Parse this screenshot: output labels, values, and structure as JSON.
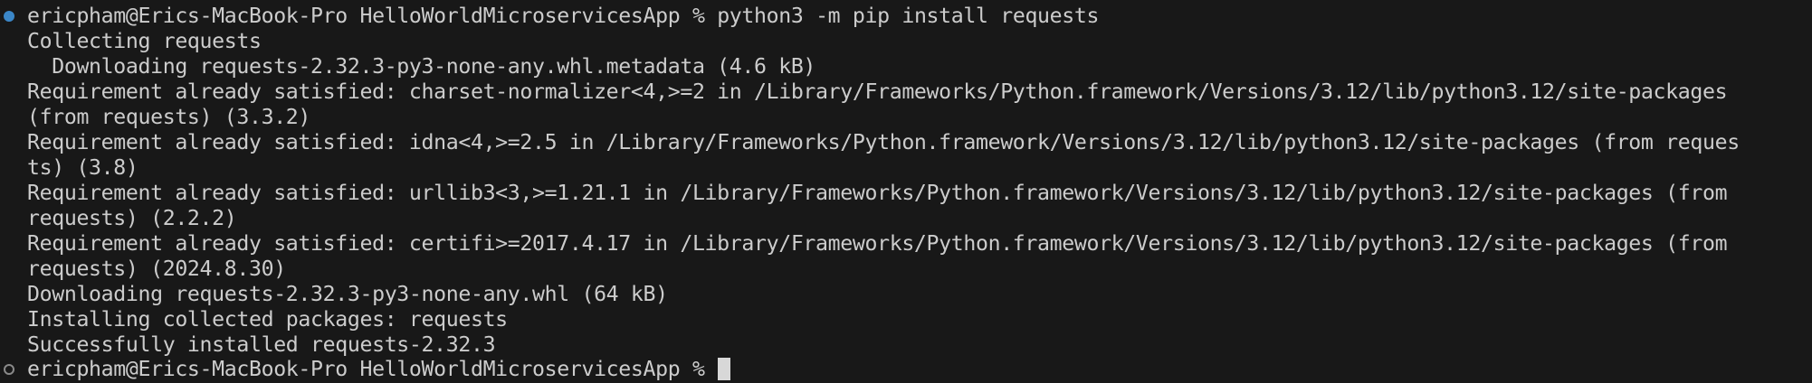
{
  "terminal": {
    "colors": {
      "background": "#181818",
      "text": "#cccccc",
      "success_marker": "#3b87c8",
      "idle_marker": "#8a8a8a"
    },
    "first_command": {
      "prompt": "ericpham@Erics-MacBook-Pro HelloWorldMicroservicesApp %",
      "command": "python3 -m pip install requests"
    },
    "output": [
      "Collecting requests",
      "  Downloading requests-2.32.3-py3-none-any.whl.metadata (4.6 kB)",
      "Requirement already satisfied: charset-normalizer<4,>=2 in /Library/Frameworks/Python.framework/Versions/3.12/lib/python3.12/site-packages",
      "(from requests) (3.3.2)",
      "Requirement already satisfied: idna<4,>=2.5 in /Library/Frameworks/Python.framework/Versions/3.12/lib/python3.12/site-packages (from reques",
      "ts) (3.8)",
      "Requirement already satisfied: urllib3<3,>=1.21.1 in /Library/Frameworks/Python.framework/Versions/3.12/lib/python3.12/site-packages (from",
      "requests) (2.2.2)",
      "Requirement already satisfied: certifi>=2017.4.17 in /Library/Frameworks/Python.framework/Versions/3.12/lib/python3.12/site-packages (from",
      "requests) (2024.8.30)",
      "Downloading requests-2.32.3-py3-none-any.whl (64 kB)",
      "Installing collected packages: requests",
      "Successfully installed requests-2.32.3"
    ],
    "current_prompt": {
      "prompt": "ericpham@Erics-MacBook-Pro HelloWorldMicroservicesApp %"
    }
  }
}
